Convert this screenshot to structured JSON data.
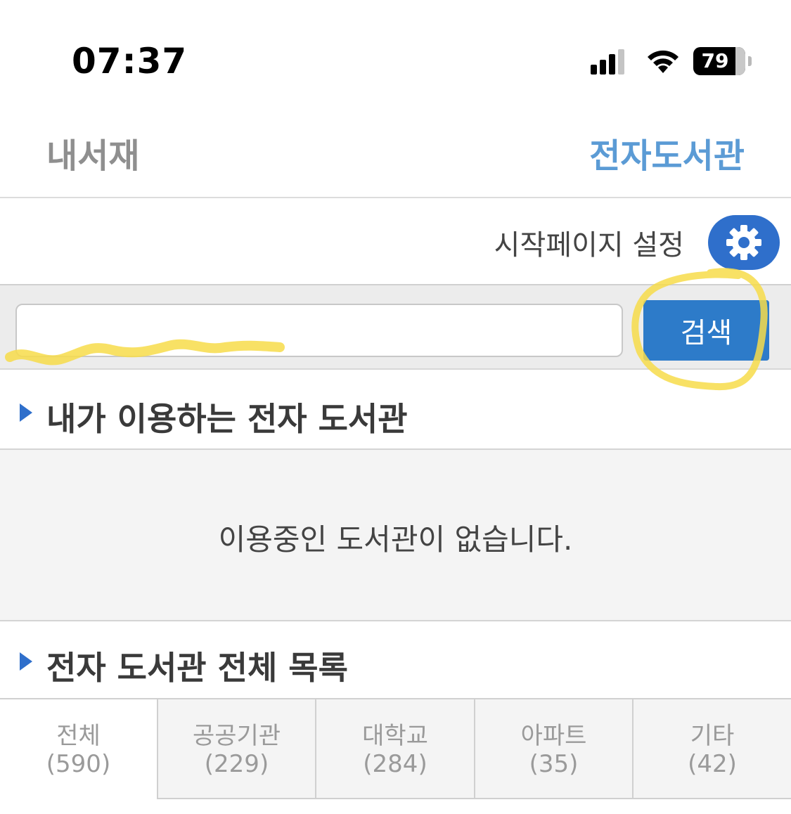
{
  "status_bar": {
    "time": "07:37",
    "battery": "79"
  },
  "header": {
    "left_title": "내서재",
    "right_title": "전자도서관"
  },
  "start_page": {
    "label": "시작페이지 설정"
  },
  "search": {
    "value": "",
    "button_label": "검색"
  },
  "my_libraries": {
    "title": "내가 이용하는 전자 도서관",
    "empty_message": "이용중인 도서관이 없습니다."
  },
  "all_libraries": {
    "title": "전자 도서관 전체 목록",
    "tabs": [
      {
        "name": "전체",
        "count": "(590)",
        "active": true
      },
      {
        "name": "공공기관",
        "count": "(229)",
        "active": false
      },
      {
        "name": "대학교",
        "count": "(284)",
        "active": false
      },
      {
        "name": "아파트",
        "count": "(35)",
        "active": false
      },
      {
        "name": "기타",
        "count": "(42)",
        "active": false
      }
    ]
  },
  "colors": {
    "accent": "#2f6fcb",
    "header_link": "#5b9bd5",
    "search_button": "#2d7bc9",
    "annotation_highlight": "#f7dc4a"
  },
  "icons": [
    "signal-icon",
    "wifi-icon",
    "battery-icon",
    "gear-icon"
  ]
}
